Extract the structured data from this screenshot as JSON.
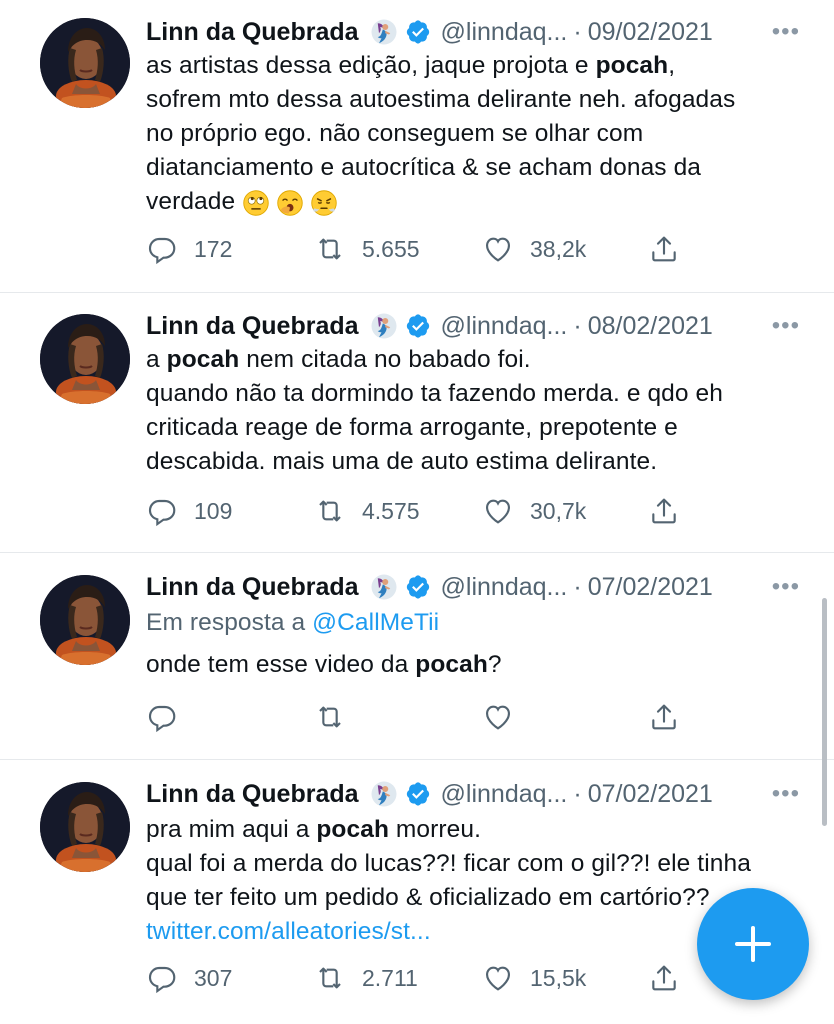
{
  "tweets": [
    {
      "name": "Linn da Quebrada",
      "handle": "@linndaq...",
      "date": "09/02/2021",
      "reply_prefix": "",
      "reply_handle": "",
      "lines": [
        [
          "as artistas dessa edição, jaque projota e ",
          "pocah",
          ","
        ],
        [
          "sofrem mto dessa autoestima delirante neh. afogadas",
          "",
          ""
        ],
        [
          "no próprio ego. não conseguem se olhar com",
          "",
          ""
        ],
        [
          "diatanciamento e autocrítica & se acham donas da",
          "",
          ""
        ],
        [
          "verdade",
          "",
          ""
        ]
      ],
      "emojis": [
        "eye-roll-emoji",
        "yawning-face-emoji",
        "steam-from-nose-emoji"
      ],
      "link": "",
      "replies": "172",
      "retweets": "5.655",
      "likes": "38,2k"
    },
    {
      "name": "Linn da Quebrada",
      "handle": "@linndaq...",
      "date": "08/02/2021",
      "reply_prefix": "",
      "reply_handle": "",
      "lines": [
        [
          "a ",
          "pocah",
          " nem citada no babado foi."
        ],
        [
          "quando não ta dormindo ta fazendo merda. e qdo eh",
          "",
          ""
        ],
        [
          "criticada reage de forma arrogante, prepotente e",
          "",
          ""
        ],
        [
          "descabida. mais uma de auto estima delirante.",
          "",
          ""
        ]
      ],
      "emojis": [],
      "link": "",
      "replies": "109",
      "retweets": "4.575",
      "likes": "30,7k"
    },
    {
      "name": "Linn da Quebrada",
      "handle": "@linndaq...",
      "date": "07/02/2021",
      "reply_prefix": "Em resposta a ",
      "reply_handle": "@CallMeTii",
      "lines": [
        [
          "onde tem esse video da ",
          "pocah",
          "?"
        ]
      ],
      "emojis": [],
      "link": "",
      "replies": "",
      "retweets": "",
      "likes": ""
    },
    {
      "name": "Linn da Quebrada",
      "handle": "@linndaq...",
      "date": "07/02/2021",
      "reply_prefix": "",
      "reply_handle": "",
      "lines": [
        [
          "pra mim aqui a ",
          "pocah",
          " morreu."
        ],
        [
          "qual foi a merda do lucas??! ficar com o gil??! ele tinha",
          "",
          ""
        ],
        [
          "que ter feito um pedido & oficializado em cartório??",
          "",
          ""
        ]
      ],
      "emojis": [],
      "link": "twitter.com/alleatories/st...",
      "replies": "307",
      "retweets": "2.711",
      "likes": "15,5k"
    }
  ],
  "icons": {
    "name_badge": "mermaid-emoji",
    "verified": "verified-badge-icon",
    "more": "more-icon",
    "reply": "reply-icon",
    "retweet": "retweet-icon",
    "like": "heart-icon",
    "share": "share-icon",
    "compose": "plus-icon"
  },
  "more_label": "•••",
  "separator": "·",
  "colors": {
    "accent": "#1d9bf0",
    "text": "#0f1419",
    "secondary": "#536471",
    "divider": "#e6e9ec"
  }
}
